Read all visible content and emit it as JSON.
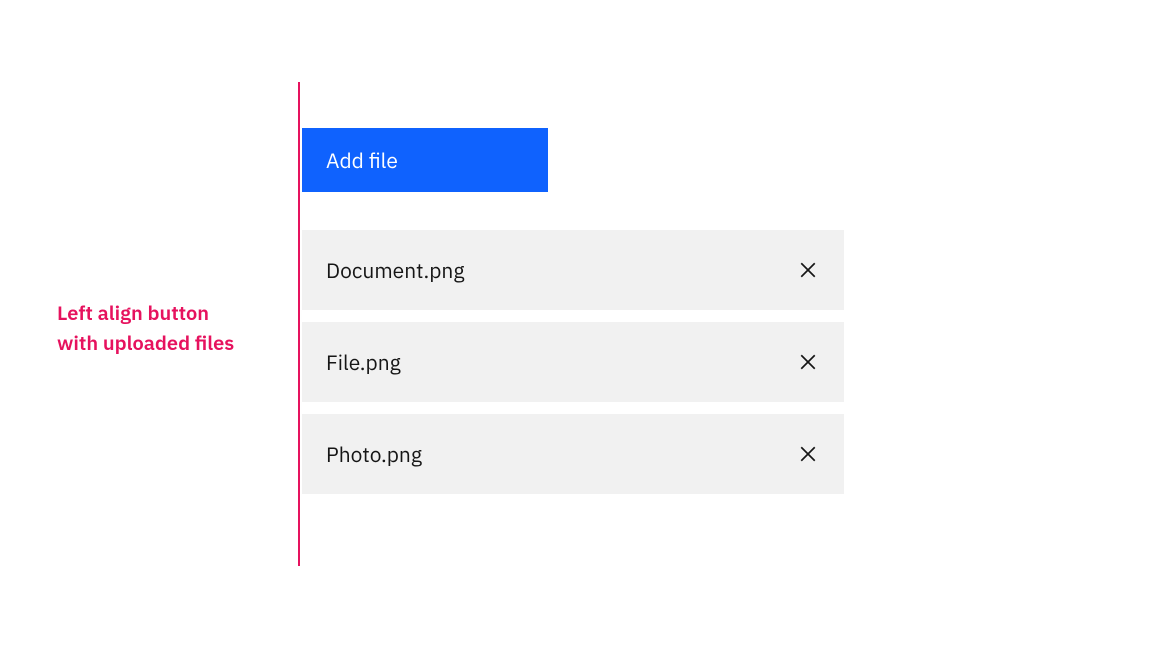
{
  "annotation": {
    "line1": "Left align button",
    "line2": "with uploaded files"
  },
  "button": {
    "label": "Add file"
  },
  "files": [
    {
      "name": "Document.png"
    },
    {
      "name": "File.png"
    },
    {
      "name": "Photo.png"
    }
  ],
  "colors": {
    "accent": "#e6125e",
    "primary": "#0f62fe",
    "fileBackground": "#f1f1f1"
  }
}
